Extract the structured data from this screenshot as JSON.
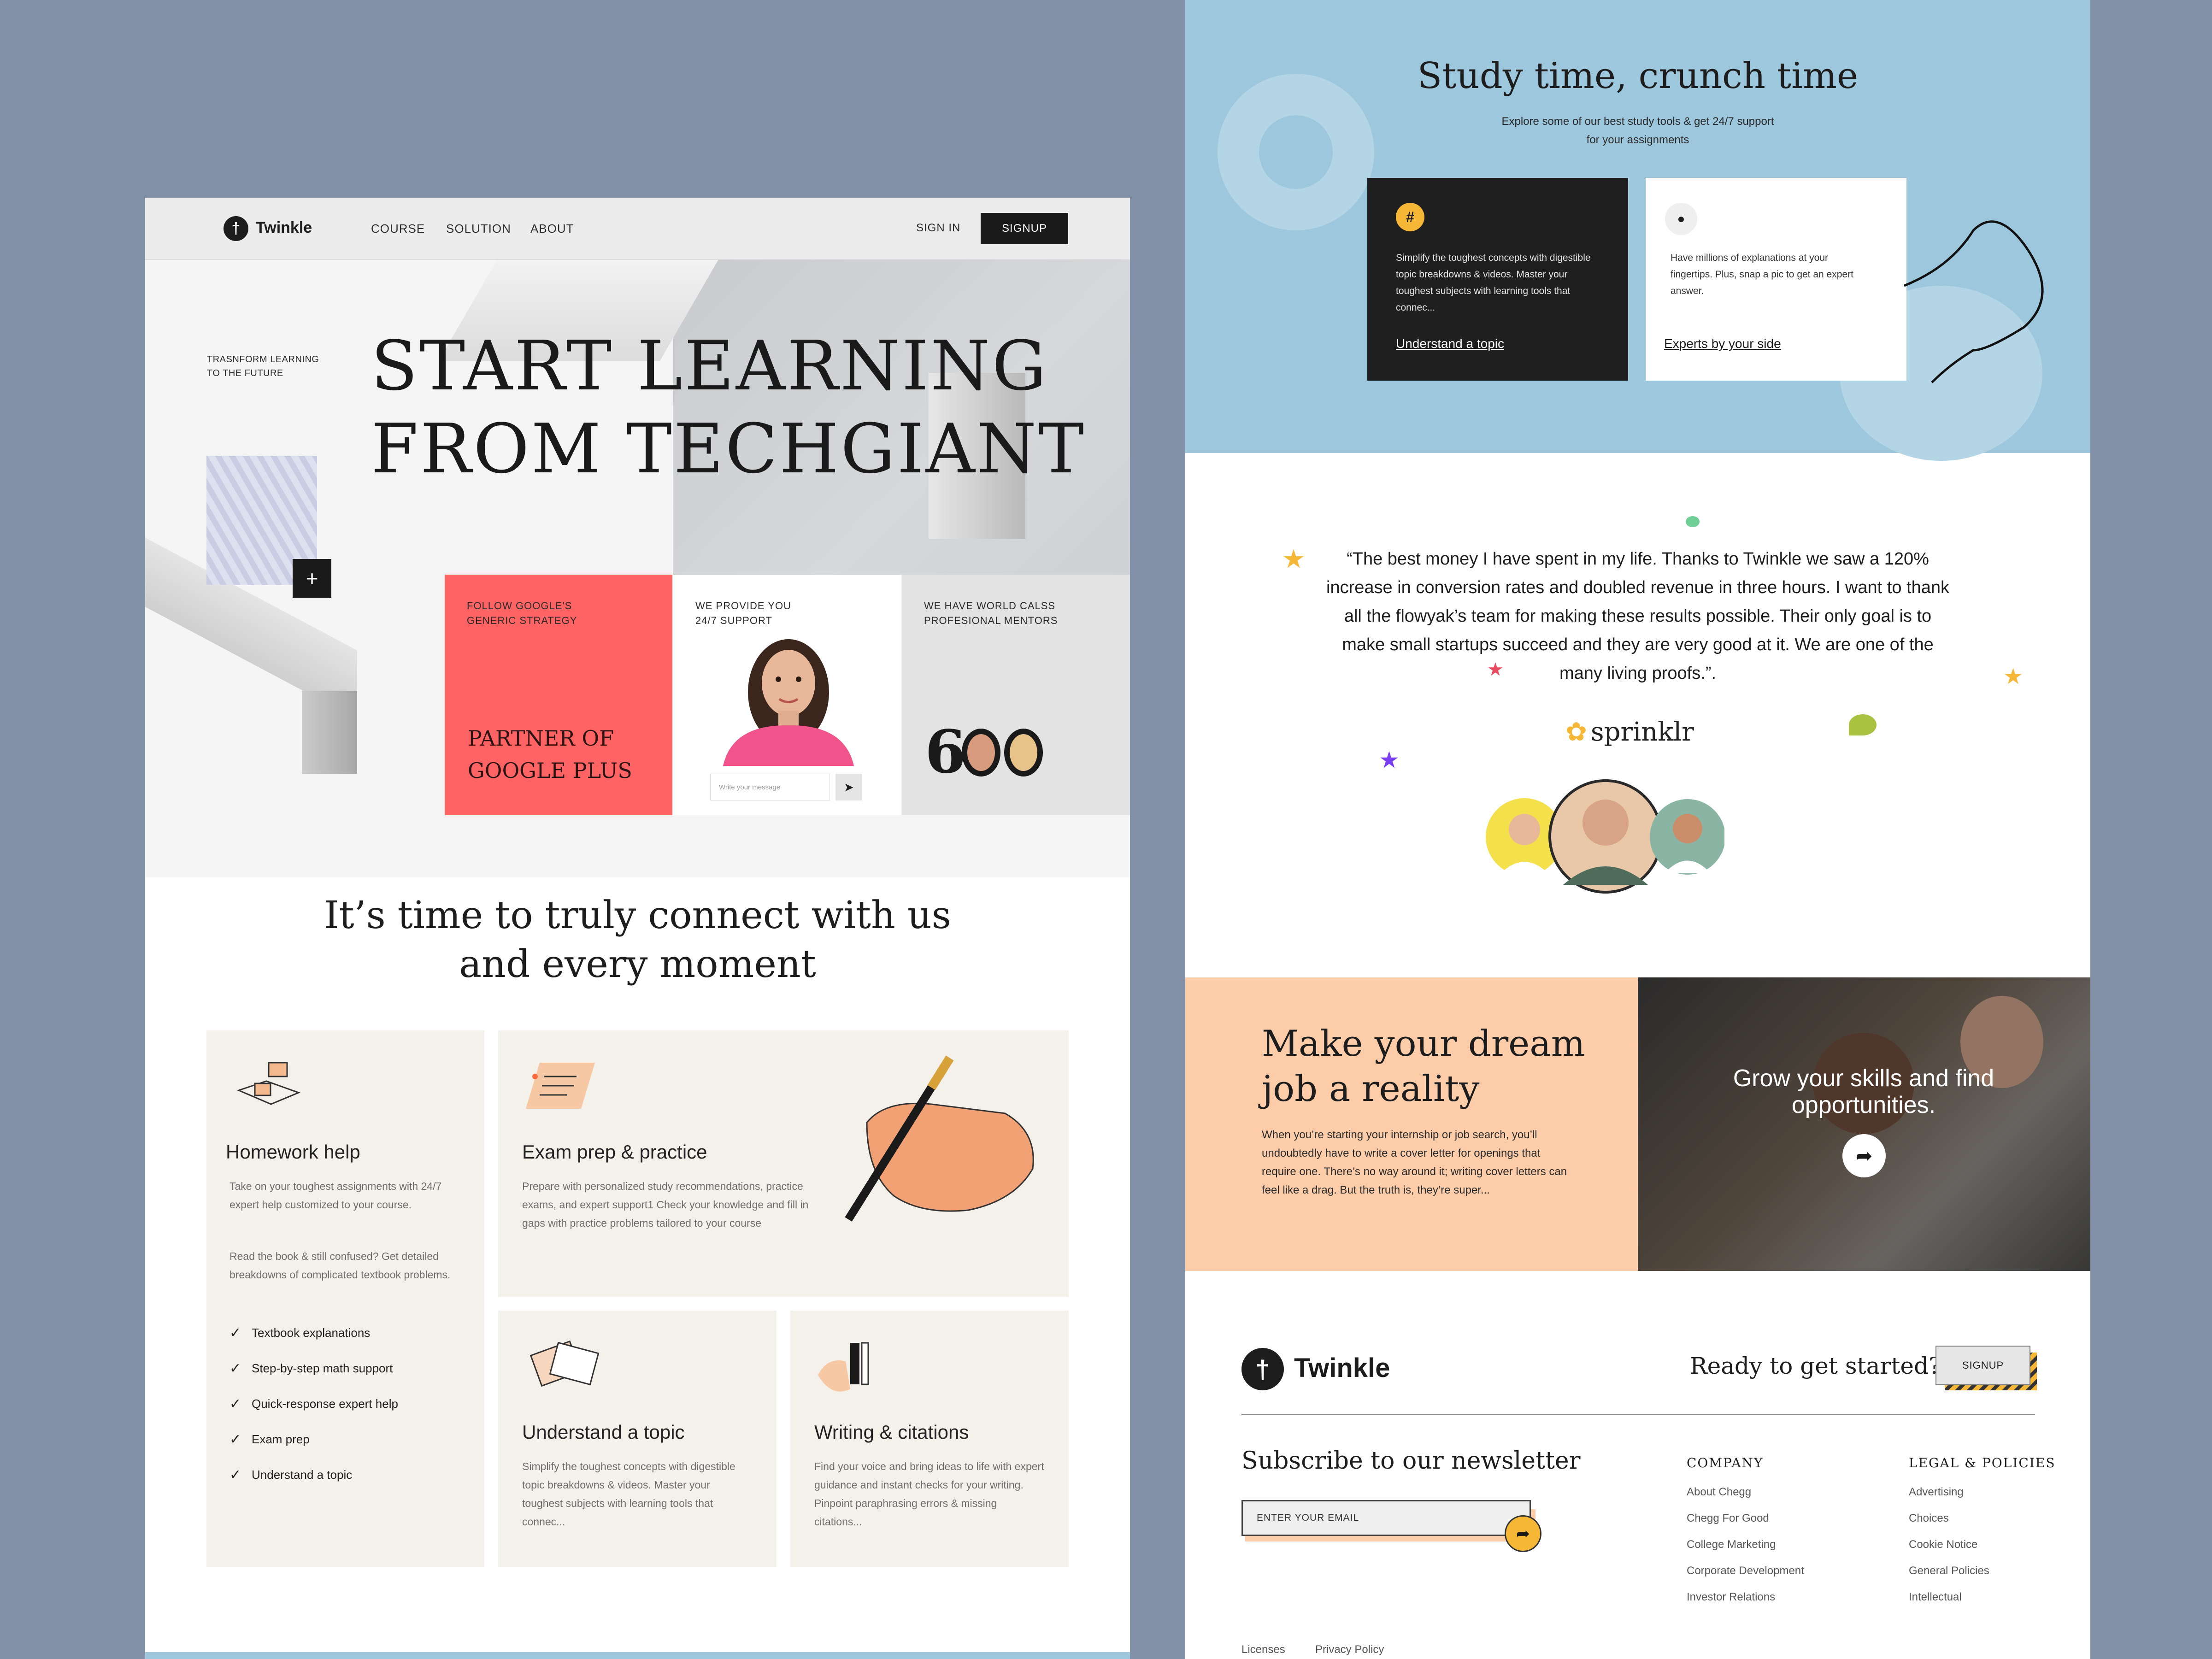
{
  "colors": {
    "background": "#8291a8",
    "accent_red": "#ff6363",
    "peach": "#fccda8",
    "blue": "#9dc7dc",
    "cream": "#f4f1ea",
    "dark": "#1a1a1a",
    "yellow": "#f5b735"
  },
  "left": {
    "nav": {
      "brand": "Twinkle",
      "links": [
        "COURSE",
        "SOLUTION",
        "ABOUT"
      ],
      "sign_in": "SIGN IN",
      "signup": "SIGNUP"
    },
    "hero": {
      "tagline_l1": "TRASNFORM LEARNING",
      "tagline_l2": "TO THE FUTURE",
      "title_l1": "START LEARNING",
      "title_l2": "FROM TECHGIANT",
      "plus": "+",
      "cards": {
        "red": {
          "tag_l1": "FOLLOW GOOGLE'S",
          "tag_l2": "GENERIC STRATEGY",
          "title_l1": "PARTNER OF",
          "title_l2": "GOOGLE PLUS"
        },
        "white": {
          "tag_l1": "WE PROVIDE YOU",
          "tag_l2": "24/7 SUPPORT",
          "placeholder": "Write your message"
        },
        "gray": {
          "tag_l1": "WE HAVE WORLD CALSS",
          "tag_l2": "PROFESIONAL MENTORS",
          "count_prefix": "6"
        }
      }
    },
    "connect": {
      "line1": "It’s time to truly connect with us",
      "line2": "and every moment"
    },
    "features": {
      "homework": {
        "title": "Homework help",
        "text1": "Take on your toughest assignments with 24/7 expert help customized to your course.",
        "text2": "Read the book & still confused? Get detailed breakdowns of complicated textbook problems.",
        "checklist": [
          "Textbook explanations",
          "Step-by-step math support",
          "Quick-response expert help",
          "Exam prep",
          "Understand a topic"
        ]
      },
      "exam": {
        "title": "Exam prep & practice",
        "text": "Prepare with personalized study recommendations, practice exams, and expert support1 Check your knowledge and fill in gaps with practice problems tailored to your course"
      },
      "topic": {
        "title": "Understand a topic",
        "text": "Simplify the toughest concepts with digestible topic breakdowns & videos. Master your toughest subjects with learning tools that connec..."
      },
      "writing": {
        "title": "Writing & citations",
        "text": "Find your voice and bring ideas to life with expert guidance and instant checks for your writing. Pinpoint paraphrasing errors & missing citations..."
      }
    }
  },
  "right": {
    "study": {
      "title": "Study time, crunch time",
      "sub_l1": "Explore some of our best study tools & get 24/7 support",
      "sub_l2": "for your assignments",
      "card1": {
        "icon": "#",
        "text": "Simplify the toughest concepts with digestible topic breakdowns & videos. Master your toughest subjects with learning tools that connec...",
        "link": "Understand a topic"
      },
      "card2": {
        "icon": "chat-icon",
        "text": "Have millions of explanations at your fingertips. Plus, snap a pic to get an expert answer.",
        "link": "Experts by your side"
      }
    },
    "testimonial": {
      "quote": "“The best money I have spent in my life. Thanks to Twinkle we saw a 120% increase in conversion rates and doubled revenue in three hours. I want to thank all the flowyak’s team for making these results possible. Their only goal is to make small startups succeed and they are very good at it. We are one of the many living proofs.”.",
      "brand": "sprinklr"
    },
    "dream": {
      "title_l1": "Make your dream",
      "title_l2": "job a reality",
      "text": "When you’re starting your internship or job search, you’ll undoubtedly have to write a cover letter for openings that require one. There’s no way around it; writing cover letters can feel like a drag. But the truth is, they’re super...",
      "photo_l1": "Grow your skills and find",
      "photo_l2": "opportunities."
    },
    "footer": {
      "brand": "Twinkle",
      "ready": "Ready to get started?",
      "signup": "SIGNUP",
      "newsletter": "Subscribe to our newsletter",
      "email_placeholder": "ENTER YOUR EMAIL",
      "company": {
        "heading": "COMPANY",
        "links": [
          "About Chegg",
          "Chegg For Good",
          "College Marketing",
          "Corporate Development",
          "Investor Relations"
        ]
      },
      "legal": {
        "heading": "LEGAL & POLICIES",
        "links": [
          "Advertising",
          "Choices",
          "Cookie Notice",
          "General Policies",
          "Intellectual"
        ]
      },
      "bottom_links": [
        "Licenses",
        "Privacy Policy"
      ]
    }
  }
}
